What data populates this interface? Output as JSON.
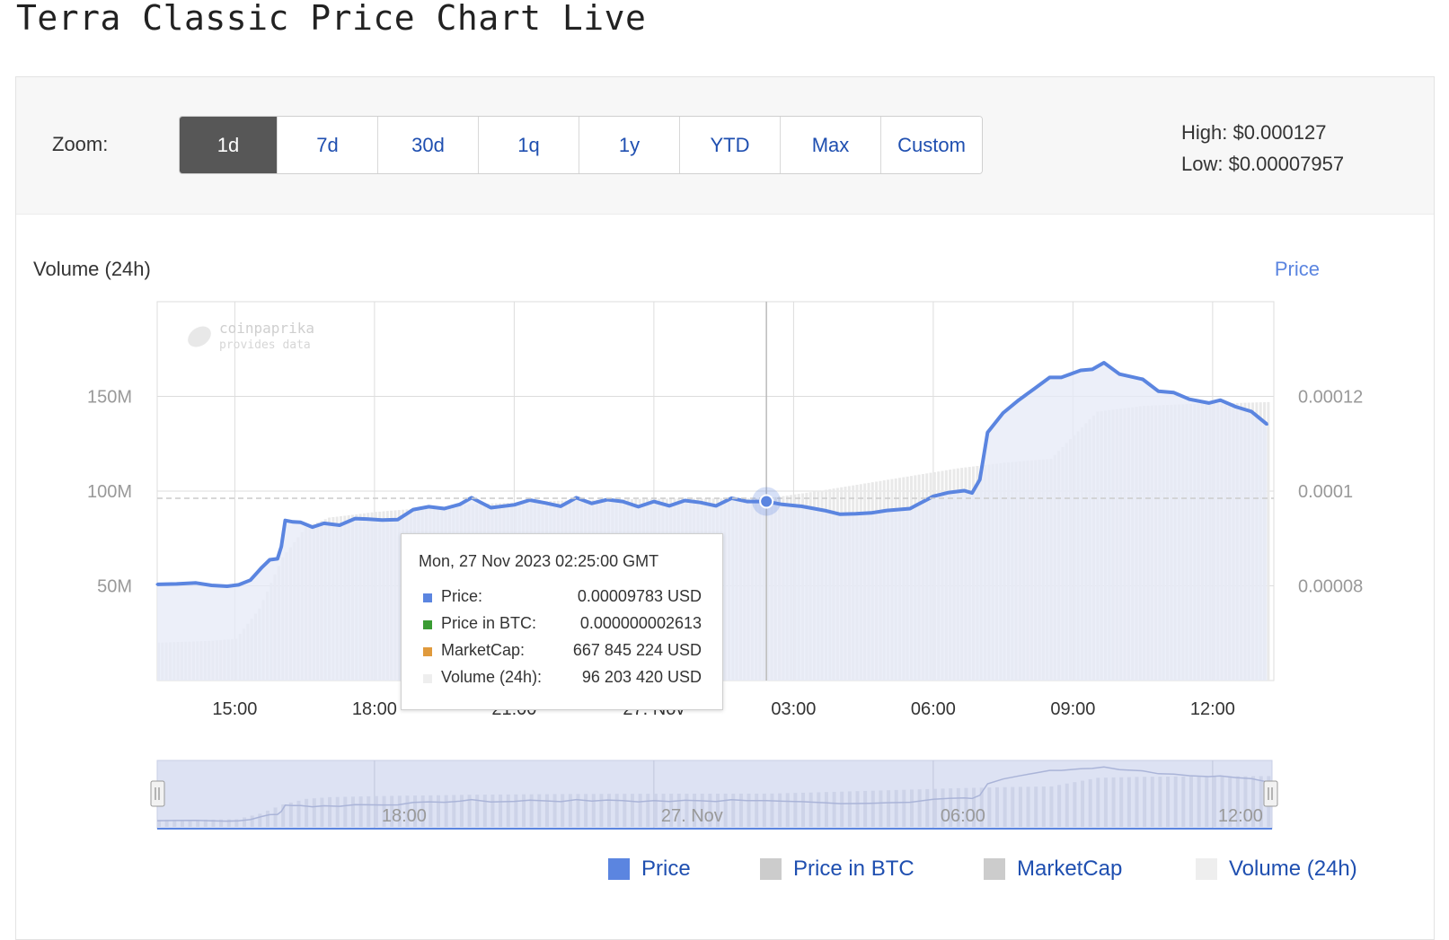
{
  "page": {
    "title": "Terra Classic Price Chart Live"
  },
  "toolbar": {
    "zoom_label": "Zoom:",
    "zoom_options": [
      "1d",
      "7d",
      "30d",
      "1q",
      "1y",
      "YTD",
      "Max",
      "Custom"
    ],
    "active_zoom": "1d",
    "high": "High: $0.000127",
    "low": "Low: $0.00007957"
  },
  "tooltip": {
    "title": "Mon, 27 Nov 2023 02:25:00 GMT",
    "rows": [
      {
        "label": "Price:",
        "value": "0.00009783 USD",
        "color": "#5b85e0"
      },
      {
        "label": "Price in BTC:",
        "value": "0.000000002613",
        "color": "#3a9c33"
      },
      {
        "label": "MarketCap:",
        "value": "667 845 224 USD",
        "color": "#e09a3c"
      },
      {
        "label": "Volume (24h):",
        "value": "96 203 420 USD",
        "color": "#eeeeee"
      }
    ]
  },
  "watermark": {
    "line1": "coinpaprika",
    "line2": "provides data"
  },
  "navigator": {
    "labels": [
      "18:00",
      "27. Nov",
      "06:00",
      "12:00"
    ]
  },
  "legend": [
    {
      "label": "Price",
      "color": "#5b85e0"
    },
    {
      "label": "Price in BTC",
      "color": "#cccccc"
    },
    {
      "label": "MarketCap",
      "color": "#cccccc"
    },
    {
      "label": "Volume (24h)",
      "color": "#eeeeee"
    }
  ],
  "colors": {
    "price_line": "#5b85e0",
    "price_fill": "#e5e9f7",
    "volume_bar": "#e9e9e9",
    "grid": "#dddddd"
  },
  "chart_data": {
    "type": "line",
    "title": "",
    "x_label": "",
    "y_left_label": "Volume (24h)",
    "y_right_label": "Price",
    "x_tick_labels": [
      "15:00",
      "18:00",
      "21:00",
      "27. Nov",
      "03:00",
      "06:00",
      "09:00",
      "12:00"
    ],
    "y_left_ticks": [
      "50M",
      "100M",
      "150M"
    ],
    "y_right_ticks": [
      "0.00008",
      "0.0001",
      "0.00012"
    ],
    "y_left_range": [
      0,
      200000000
    ],
    "y_right_range": [
      6e-05,
      0.00014
    ],
    "grid": true,
    "legend_position": "bottom-right",
    "series": [
      {
        "name": "Price",
        "axis": "right",
        "x": [
          "13:20",
          "13:45",
          "14:10",
          "14:30",
          "14:50",
          "15:05",
          "15:20",
          "15:35",
          "15:45",
          "15:55",
          "16:00",
          "16:05",
          "16:15",
          "16:25",
          "16:40",
          "16:55",
          "17:15",
          "17:35",
          "17:50",
          "18:10",
          "18:30",
          "18:50",
          "19:10",
          "19:30",
          "19:50",
          "20:05",
          "20:30",
          "21:00",
          "21:20",
          "21:40",
          "22:00",
          "22:20",
          "22:40",
          "23:00",
          "23:20",
          "23:40",
          "00:00",
          "00:20",
          "00:40",
          "01:00",
          "01:20",
          "01:40",
          "02:00",
          "02:25",
          "02:45",
          "03:10",
          "03:40",
          "04:00",
          "04:20",
          "04:40",
          "05:00",
          "05:30",
          "06:00",
          "06:20",
          "06:40",
          "06:50",
          "07:00",
          "07:10",
          "07:30",
          "07:50",
          "08:10",
          "08:30",
          "08:45",
          "08:55",
          "09:10",
          "09:25",
          "09:40",
          "10:00",
          "10:30",
          "10:50",
          "11:10",
          "11:30",
          "11:55",
          "12:10",
          "12:30",
          "12:50",
          "13:10"
        ],
        "y": [
          8.03e-05,
          8.04e-05,
          8.06e-05,
          8.01e-05,
          7.99e-05,
          8.02e-05,
          8.12e-05,
          8.39e-05,
          8.55e-05,
          8.57e-05,
          8.83e-05,
          9.38e-05,
          9.35e-05,
          9.34e-05,
          9.24e-05,
          9.32e-05,
          9.28e-05,
          9.42e-05,
          9.41e-05,
          9.39e-05,
          9.4e-05,
          9.61e-05,
          9.67e-05,
          9.63e-05,
          9.72e-05,
          9.86e-05,
          9.65e-05,
          9.71e-05,
          9.81e-05,
          9.75e-05,
          9.68e-05,
          9.86e-05,
          9.74e-05,
          9.82e-05,
          9.78e-05,
          9.67e-05,
          9.78e-05,
          9.69e-05,
          9.8e-05,
          9.76e-05,
          9.69e-05,
          9.85e-05,
          9.78e-05,
          9.78e-05,
          9.72e-05,
          9.68e-05,
          9.59e-05,
          9.51e-05,
          9.52e-05,
          9.54e-05,
          9.59e-05,
          9.63e-05,
          9.89e-05,
          9.97e-05,
          0.0001001,
          9.96e-05,
          0.0001024,
          0.0001124,
          0.0001165,
          0.0001192,
          0.0001216,
          0.000124,
          0.000124,
          0.0001246,
          0.0001255,
          0.0001257,
          0.0001271,
          0.0001247,
          0.0001236,
          0.0001211,
          0.0001208,
          0.0001194,
          0.0001186,
          0.0001192,
          0.0001178,
          0.0001168,
          0.0001141
        ]
      },
      {
        "name": "Volume (24h)",
        "axis": "left",
        "x": [
          "13:20",
          "14:30",
          "15:00",
          "15:30",
          "16:00",
          "16:30",
          "17:00",
          "18:00",
          "19:00",
          "20:00",
          "21:00",
          "22:00",
          "23:00",
          "00:00",
          "01:00",
          "02:25",
          "03:30",
          "04:30",
          "05:30",
          "06:30",
          "07:30",
          "08:30",
          "09:30",
          "10:30",
          "11:30",
          "12:30",
          "13:10"
        ],
        "y": [
          20000000,
          21000000,
          22000000,
          38000000,
          65000000,
          81000000,
          86000000,
          89000000,
          91000000,
          93000000,
          94000000,
          95000000,
          95500000,
          96000000,
          96100000,
          96203420,
          100000000,
          104000000,
          108000000,
          112000000,
          115000000,
          117000000,
          142000000,
          145000000,
          146000000,
          146500000,
          147000000
        ]
      }
    ],
    "hovered_point": {
      "x": "02:25",
      "price": 9.783e-05,
      "volume": 96203420
    }
  }
}
